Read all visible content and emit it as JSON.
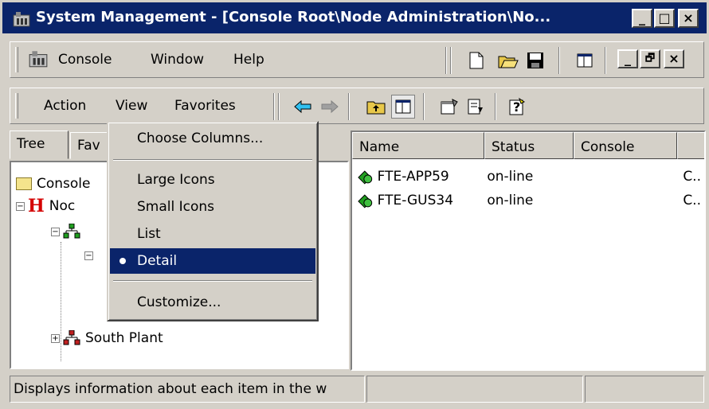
{
  "window": {
    "title": "System Management - [Console Root\\Node Administration\\No..."
  },
  "menubar": {
    "items": [
      "Console",
      "Window",
      "Help"
    ]
  },
  "actionbar": {
    "items": [
      "Action",
      "View",
      "Favorites"
    ]
  },
  "tabs": [
    "Tree",
    "Fav"
  ],
  "tree": {
    "items": [
      {
        "label": "Console"
      },
      {
        "label": "Noc"
      },
      {
        "label": "South Plant"
      }
    ]
  },
  "list": {
    "columns": [
      "Name",
      "Status",
      "Console"
    ],
    "rows": [
      {
        "name": "FTE-APP59",
        "status": "on-line",
        "console": "C.."
      },
      {
        "name": "FTE-GUS34",
        "status": "on-line",
        "console": "C.."
      }
    ]
  },
  "view_menu": {
    "items": [
      "Choose Columns...",
      "Large Icons",
      "Small Icons",
      "List",
      "Detail",
      "Customize..."
    ],
    "selected": "Detail"
  },
  "statusbar": {
    "text": "Displays information about each item in the w"
  },
  "icons": [
    "app-icon",
    "new-icon",
    "open-folder-icon",
    "save-icon",
    "back-arrow-icon",
    "forward-arrow-icon",
    "up-folder-icon",
    "show-hide-tree-icon",
    "properties-icon",
    "export-list-icon",
    "help-icon",
    "node-icon"
  ]
}
